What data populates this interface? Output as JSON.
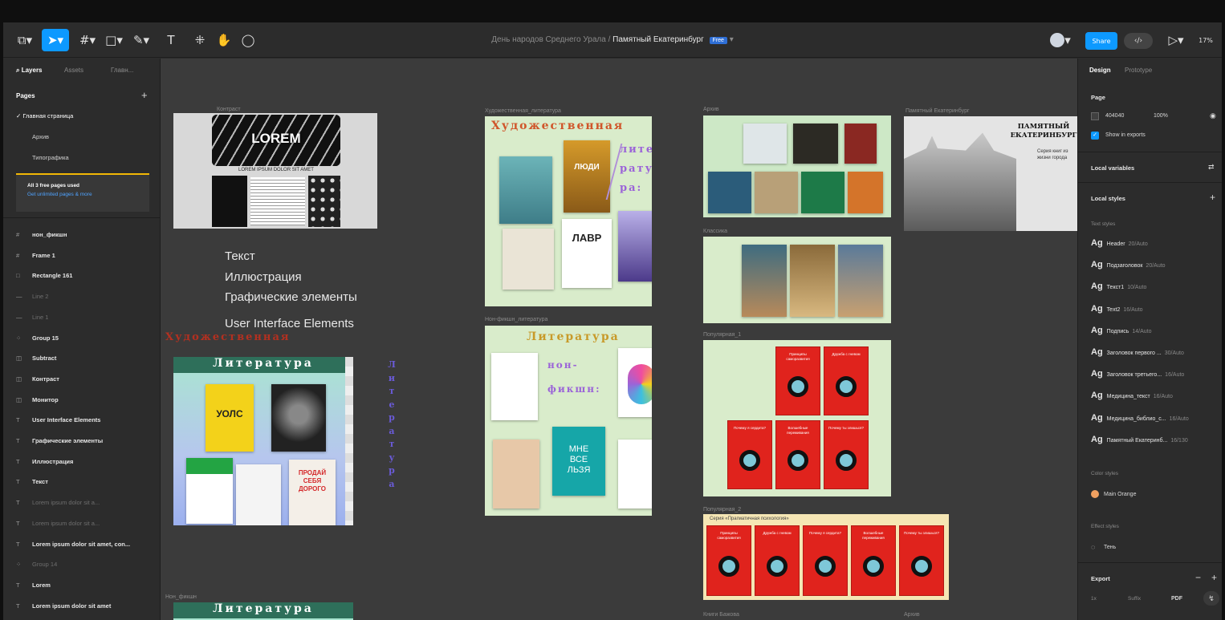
{
  "toolbar": {
    "document_path": "День народов Среднего Урала",
    "separator": "/",
    "file_name": "Памятный Екатеринбург",
    "plan_badge": "Free",
    "share_label": "Share",
    "zoom": "17%"
  },
  "left_panel": {
    "tabs": [
      "Layers",
      "Assets",
      "Главн..."
    ],
    "pages_title": "Pages",
    "pages": [
      "Главная страница",
      "Архив",
      "Типографика"
    ],
    "notice_title": "All 3 free pages used",
    "notice_link": "Get unlimited pages & more",
    "layers": [
      {
        "name": "нон_фикшн",
        "dim": false
      },
      {
        "name": "Frame 1",
        "dim": false
      },
      {
        "name": "Rectangle 161",
        "dim": false
      },
      {
        "name": "Line 2",
        "dim": true
      },
      {
        "name": "Line 1",
        "dim": true
      },
      {
        "name": "Group 15",
        "dim": false
      },
      {
        "name": "Subtract",
        "dim": false
      },
      {
        "name": "Контраст",
        "dim": false
      },
      {
        "name": "Монитор",
        "dim": false
      },
      {
        "name": "User Interface Elements",
        "dim": false
      },
      {
        "name": "Графические элементы",
        "dim": false
      },
      {
        "name": "Иллюстрация",
        "dim": false
      },
      {
        "name": "Текст",
        "dim": false
      },
      {
        "name": "Lorem ipsum dolor sit a...",
        "dim": true
      },
      {
        "name": "Lorem ipsum dolor sit a...",
        "dim": true
      },
      {
        "name": "Lorem ipsum dolor sit amet, con...",
        "dim": false
      },
      {
        "name": "Group 14",
        "dim": true
      },
      {
        "name": "Lorem",
        "dim": false
      },
      {
        "name": "Lorem ipsum dolor sit amet",
        "dim": false
      }
    ]
  },
  "right_panel": {
    "tabs": [
      "Design",
      "Prototype"
    ],
    "page_title": "Page",
    "bg_hex": "404040",
    "bg_opacity": "100%",
    "show_exports": "Show in exports",
    "local_variables": "Local variables",
    "local_styles": "Local styles",
    "text_styles_title": "Text styles",
    "text_styles": [
      {
        "name": "Header",
        "spec": "20/Auto"
      },
      {
        "name": "Подзаголовок",
        "spec": "20/Auto"
      },
      {
        "name": "Текст1",
        "spec": "10/Auto"
      },
      {
        "name": "Text2",
        "spec": "16/Auto"
      },
      {
        "name": "Подпись",
        "spec": "14/Auto"
      },
      {
        "name": "Заголовок первого ...",
        "spec": "30/Auto"
      },
      {
        "name": "Заголовок третьего...",
        "spec": "16/Auto"
      },
      {
        "name": "Медицина_текст",
        "spec": "16/Auto"
      },
      {
        "name": "Медицина_библио_с...",
        "spec": "16/Auto"
      },
      {
        "name": "Памятный Екатеринб...",
        "spec": "16/130"
      }
    ],
    "color_styles_title": "Color styles",
    "color_style": "Main Orange",
    "effect_styles_title": "Effect styles",
    "effect_style": "Тень",
    "export_title": "Export",
    "export_scale": "1x",
    "export_suffix": "Suffix",
    "export_format": "PDF"
  },
  "canvas": {
    "labels": {
      "lorem_frame": "Контраст",
      "hud": "Художественная_литература",
      "nonfic": "Нон-фикшн_литература",
      "mid_top": "Архив",
      "mid2": "Классика",
      "mid3": "Популярная_1",
      "mid4": "Популярная_2",
      "pamyat": "Памятный Екатеринбург",
      "bottom1": "Нон_фикшн",
      "bottom2": "Книги Бажова",
      "bottom3": "Архив"
    },
    "lorem_title": "LOREM",
    "lorem_sub": "LOREM IPSUM DOLOR SIT AMET",
    "items": [
      "Текст",
      "Иллюстрация",
      "Графические элементы",
      "User Interface Elements"
    ],
    "hud_title": "Художественная",
    "hud_lite": [
      "лите-",
      "рату-",
      "ра:"
    ],
    "literatura": "Литература",
    "nonfic_words": [
      "нон-",
      "фикшн:"
    ],
    "vertical_word": [
      "Л",
      "и",
      "т",
      "е",
      "р",
      "а",
      "т",
      "у",
      "р",
      "а"
    ],
    "pamyat_title_1": "ПАМЯТНЫЙ",
    "pamyat_title_2": "ЕКАТЕРИНБУРГ",
    "pamyat_sub": "Серия книг из жизни города",
    "book_lavr": "ЛАВР",
    "book_uols": "УОЛС",
    "book_sebya": [
      "ПРОДАЙ",
      "СЕБЯ",
      "ДОРОГО"
    ],
    "book_mne": [
      "МНЕ",
      "ВСЕ",
      "ЛЬЗЯ"
    ],
    "book_lyudi": "ЛЮДИ",
    "series_label": "Серия «Прагматичная психология»",
    "red_book_titles": [
      "Принципы саморазвития",
      "Дружба с гневом",
      "Почему я сердита?",
      "Волшебные переживания",
      "Почему ты злишься?"
    ]
  },
  "colors": {
    "accent": "#0d99ff",
    "canvas_bg": "#3b3b3b",
    "panel_bg": "#2c2c2c",
    "main_orange": "#f0a060",
    "notice_border": "#f2b705"
  }
}
